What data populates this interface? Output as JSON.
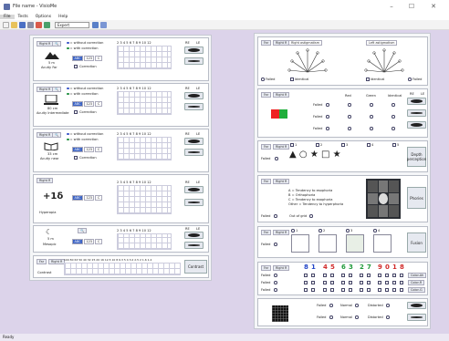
{
  "window": {
    "title": "File name - VisioMe",
    "min": "–",
    "max": "☐",
    "close": "✕"
  },
  "menu": [
    "File",
    "Tests",
    "Options",
    "Help"
  ],
  "toolbar": {
    "select_value": "Expert"
  },
  "status": "Ready",
  "left": {
    "card1": {
      "tab": "Right R",
      "leg1": "= without correction",
      "leg2": "= with correction",
      "scale": "2 3 4 5 6 7 8 9 10 12",
      "re": "RE",
      "le": "LE",
      "dist": "5 m",
      "label": "Acuity Far",
      "abc": [
        "ABC",
        "123",
        "C"
      ],
      "corr": "Correction"
    },
    "card2": {
      "tab": "Right R",
      "leg1": "= without correction",
      "leg2": "= with correction",
      "scale": "2 3 4 5 6 7 8 9 10 12",
      "re": "RE",
      "le": "LE",
      "dist": "80 cm",
      "label": "Acuity Intermediate",
      "abc": [
        "ABC",
        "123",
        "C"
      ],
      "corr": "Correction"
    },
    "card3": {
      "tab": "Right R",
      "leg1": "= without correction",
      "leg2": "= with correction",
      "scale": "2 3 4 5 6 7 8 9 10 12",
      "re": "RE",
      "le": "LE",
      "dist": "33 cm",
      "label": "Acuity near",
      "abc": [
        "ABC",
        "123",
        "C"
      ],
      "corr": "Correction"
    },
    "card4": {
      "tab": "Right R",
      "scale": "2 3 4 5 6 7 8 9 10 12",
      "re": "RE",
      "le": "LE",
      "big": "+1δ",
      "label": "Hyperopia",
      "abc": [
        "ABC",
        "123",
        "C"
      ]
    },
    "card5": {
      "scale": "2 3 4 5 6 7 8 9 10 12",
      "re": "RE",
      "le": "LE",
      "dist": "5 m",
      "label": "Mesopic",
      "abc": [
        "ABC",
        "123",
        "C"
      ]
    },
    "card6": {
      "tab1": "Far",
      "tab2": "Right R",
      "scale": "100 80 63 50 40 32 25 20 16 12.5 10 8 6.3 5 4 3.2 2.5 2 1.6 1.2",
      "label": "Contrast",
      "button": "Contrast"
    }
  },
  "right": {
    "astig": {
      "tab1": "Far",
      "tab2": "Right R",
      "right_tab": "Right astigmatism",
      "left_tab": "Left astigmatism",
      "failed": "Failed",
      "identical": "Identical",
      "failed2": "Failed"
    },
    "colour": {
      "tab1": "Far",
      "tab2": "Right R",
      "red": "Red",
      "green": "Green",
      "identical": "Identical",
      "re": "RE",
      "le": "LE",
      "failed": "Failed"
    },
    "depth": {
      "tab1": "Far",
      "tab2": "Right R",
      "failed": "Failed",
      "labels": [
        "1",
        "2",
        "3",
        "4",
        "5"
      ],
      "button": "Depth perception"
    },
    "phoria": {
      "tab1": "Far",
      "tab2": "Right R",
      "line1": "A = Tendency to esophoria",
      "line2": "B = Orthophoria",
      "line3": "C = Tendency to exophoria",
      "line4": "Other = Tendency to hyperphoria",
      "failed": "Failed",
      "oog": "Out of grid",
      "button": "Phories"
    },
    "fusion": {
      "tab1": "Far",
      "tab2": "Right R",
      "failed": "Failed",
      "labels": [
        "1",
        "2",
        "3",
        "4"
      ],
      "button": "Fusion"
    },
    "colortest": {
      "tab1": "Far",
      "tab2": "Right R",
      "failed": "Failed",
      "numbers": [
        "8",
        "1",
        "4",
        "5",
        "6",
        "3",
        "2",
        "7",
        "9",
        "0",
        "1",
        "8"
      ],
      "b1": "Color-Ah",
      "b2": "Color-R",
      "b3": "Color-G"
    },
    "amsler": {
      "failed": "Failed",
      "normal": "Normal",
      "distorted": "Distorted"
    }
  }
}
